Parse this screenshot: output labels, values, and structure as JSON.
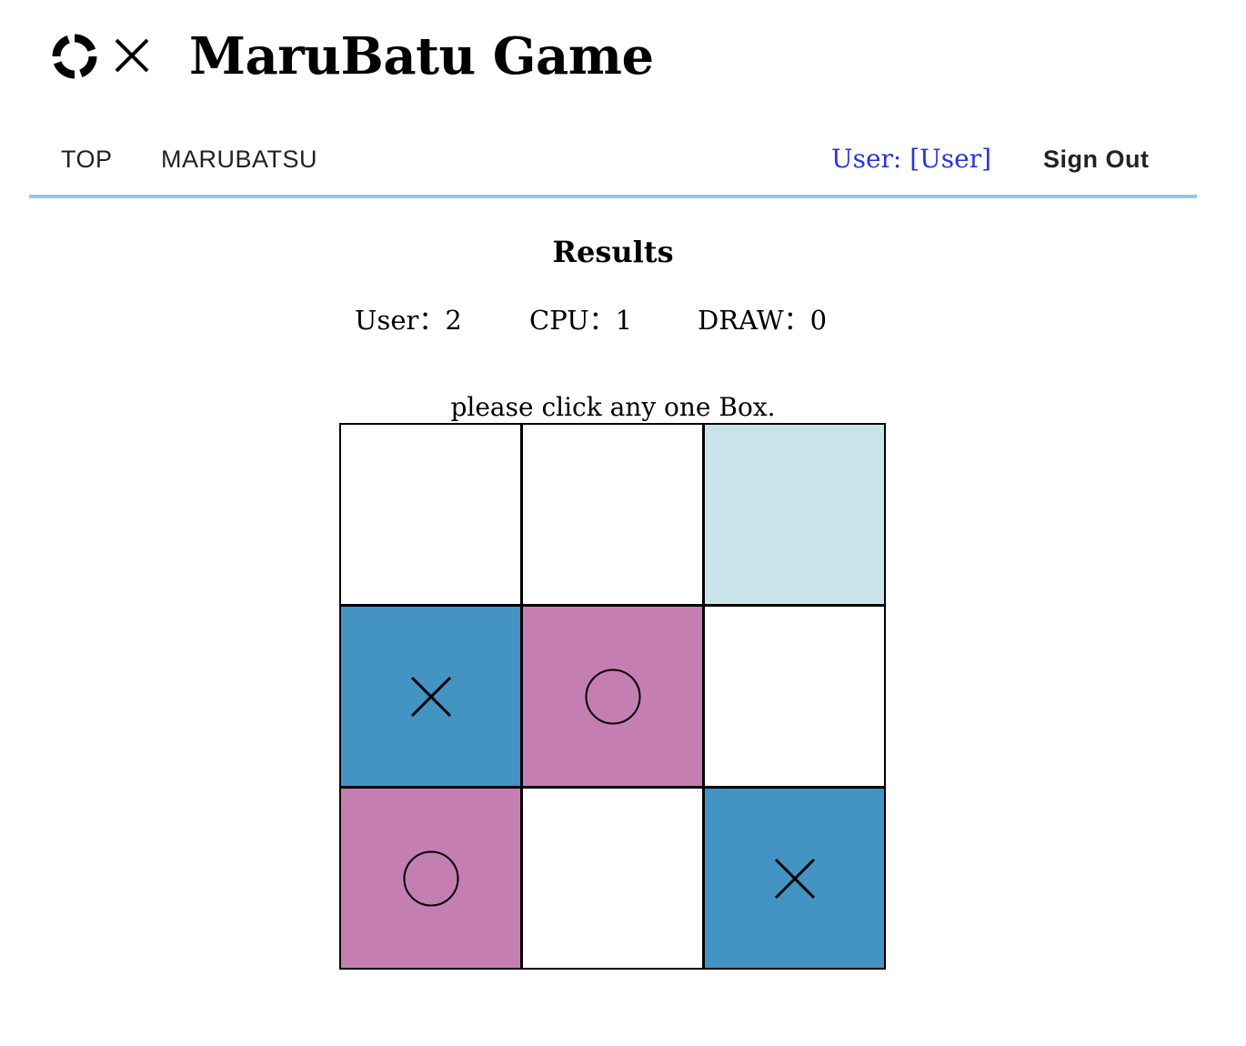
{
  "header": {
    "logo_icon": "maru-batsu-logo-icon",
    "title": "MaruBatu Game"
  },
  "nav": {
    "top": "TOP",
    "marubatsu": "MARUBATSU",
    "user": "User: [User]",
    "sign_out": "Sign Out"
  },
  "results": {
    "heading": "Results",
    "user": "User：2",
    "cpu": "CPU：1",
    "draw": "DRAW：0"
  },
  "instruction": "please click any one Box.",
  "colors": {
    "accent_line": "#90cce8",
    "user_link": "#2a32e0",
    "x_cell": "#4393c3",
    "o_cell": "#c57eb2",
    "highlight_cell": "#c8e3ea",
    "empty_cell": "#ffffff"
  },
  "board": {
    "cells": [
      {
        "mark": "",
        "state": "empty"
      },
      {
        "mark": "",
        "state": "empty"
      },
      {
        "mark": "",
        "state": "highlight"
      },
      {
        "mark": "x",
        "state": "x"
      },
      {
        "mark": "o",
        "state": "o"
      },
      {
        "mark": "",
        "state": "empty"
      },
      {
        "mark": "o",
        "state": "o"
      },
      {
        "mark": "",
        "state": "empty"
      },
      {
        "mark": "x",
        "state": "x"
      }
    ]
  }
}
